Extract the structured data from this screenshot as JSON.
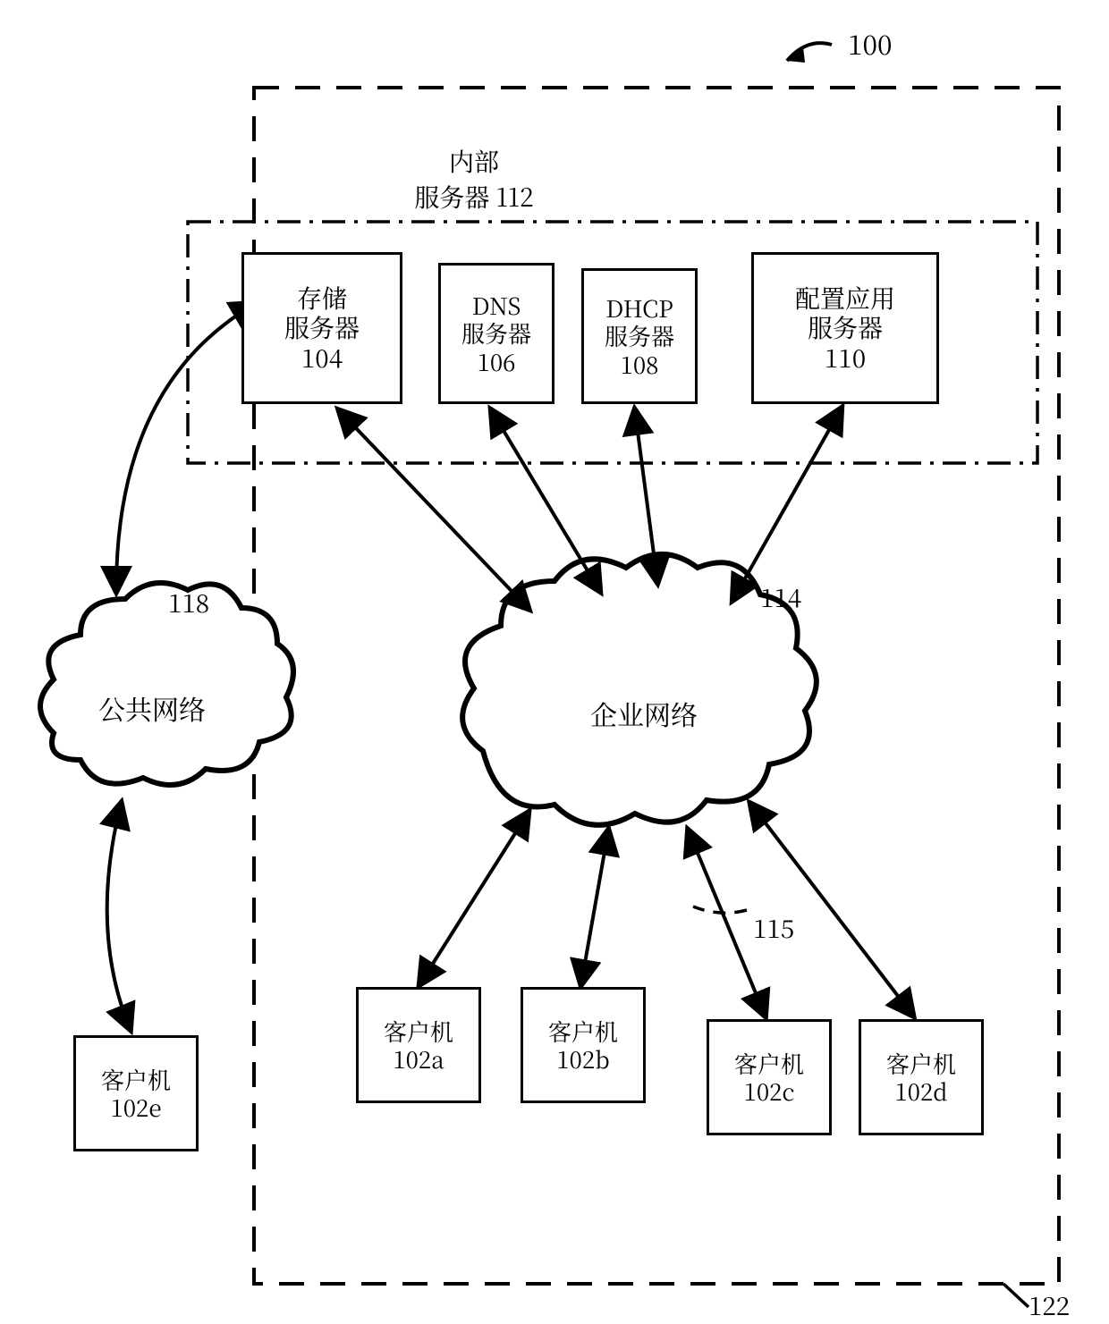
{
  "figure_ref": "100",
  "outer_boundary_ref": "122",
  "internal_servers": {
    "label_line1": "内部",
    "label_line2": "服务器 112"
  },
  "servers": {
    "storage": {
      "line1": "存储",
      "line2": "服务器",
      "ref": "104"
    },
    "dns": {
      "line1": "DNS",
      "line2": "服务器",
      "ref": "106"
    },
    "dhcp": {
      "line1": "DHCP",
      "line2": "服务器",
      "ref": "108"
    },
    "configapp": {
      "line1": "配置应用",
      "line2": "服务器",
      "ref": "110"
    }
  },
  "clouds": {
    "public": {
      "label": "公共网络",
      "ref": "118"
    },
    "enterprise": {
      "label": "企业网络",
      "ref": "114"
    }
  },
  "link_ref": "115",
  "clients": {
    "a": {
      "label": "客户机",
      "ref": "102a"
    },
    "b": {
      "label": "客户机",
      "ref": "102b"
    },
    "c": {
      "label": "客户机",
      "ref": "102c"
    },
    "d": {
      "label": "客户机",
      "ref": "102d"
    },
    "e": {
      "label": "客户机",
      "ref": "102e"
    }
  }
}
